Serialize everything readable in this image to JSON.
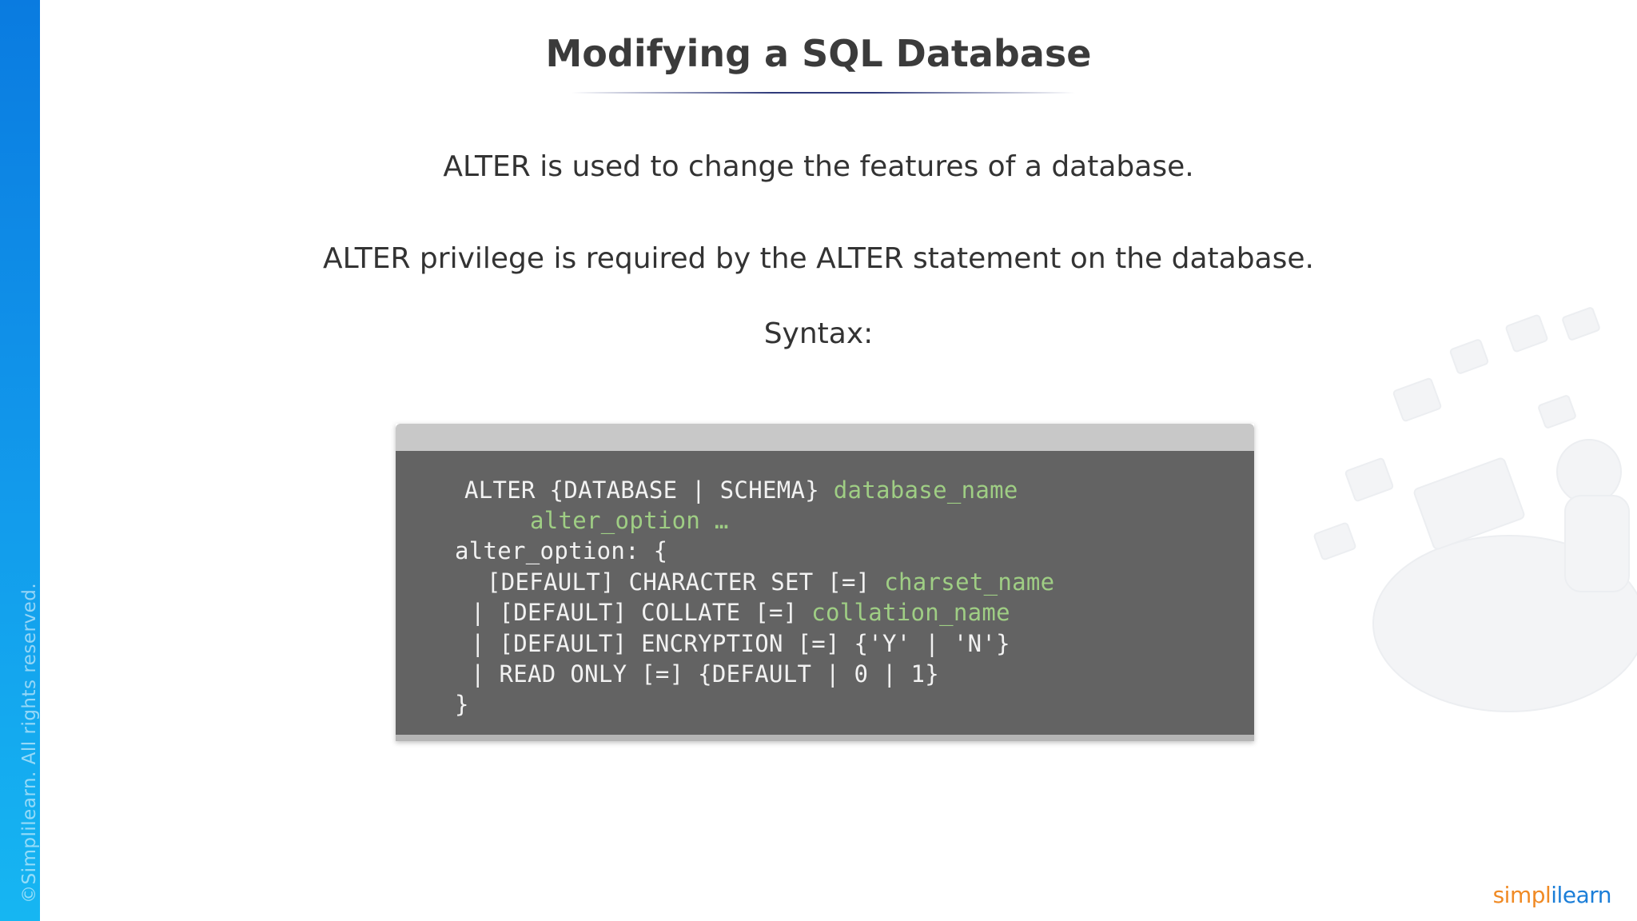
{
  "slide": {
    "title": "Modifying a SQL Database",
    "lines": [
      "ALTER is used to change the features of a database.",
      "ALTER privilege is required by the ALTER statement on the database.",
      "Syntax:"
    ]
  },
  "code": {
    "lines": [
      [
        {
          "text": "ALTER {DATABASE | SCHEMA} ",
          "style": "plain"
        },
        {
          "text": "database_name",
          "style": "green"
        }
      ],
      [
        {
          "text": "alter_option …",
          "style": "green"
        }
      ],
      [
        {
          "text": "alter_option: {",
          "style": "plain"
        }
      ],
      [
        {
          "text": "[DEFAULT] CHARACTER SET [=] ",
          "style": "plain"
        },
        {
          "text": "charset_name",
          "style": "green"
        }
      ],
      [
        {
          "text": "| [DEFAULT] COLLATE [=] ",
          "style": "plain"
        },
        {
          "text": "collation_name",
          "style": "green"
        }
      ],
      [
        {
          "text": "| [DEFAULT] ENCRYPTION [=] {'Y' | 'N'}",
          "style": "plain"
        }
      ],
      [
        {
          "text": "| READ ONLY [=] {DEFAULT | 0 | 1}",
          "style": "plain"
        }
      ],
      [
        {
          "text": "}",
          "style": "plain"
        }
      ]
    ],
    "colors": {
      "background": "#636363",
      "titlebar": "#c8c8c8",
      "plain_text": "#f2f2f2",
      "highlight_text": "#9fce84"
    }
  },
  "footer": {
    "copyright": "©Simplilearn. All rights reserved.",
    "logo_part1": "simpl",
    "logo_part2": "ilearn"
  },
  "colors": {
    "side_strip_top": "#0a7be0",
    "side_strip_bottom": "#16b6f2",
    "title_rule": "#2f3a7a",
    "logo_orange": "#f08a24",
    "logo_blue": "#1b7ed8"
  }
}
